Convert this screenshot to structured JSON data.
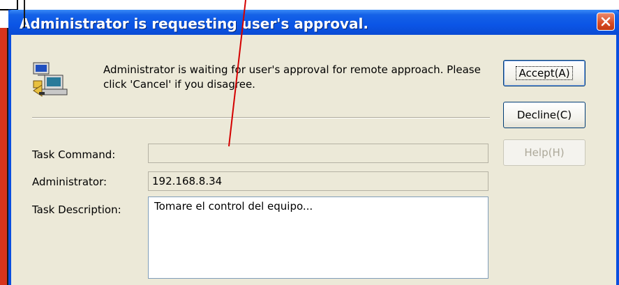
{
  "dialog": {
    "title": "Administrator is requesting user's approval.",
    "message": "Administrator is waiting for user's approval for remote approach. Please click 'Cancel' if you disagree.",
    "fields": {
      "task_command_label": "Task Command:",
      "task_command_value": "",
      "administrator_label": "Administrator:",
      "administrator_value": "192.168.8.34",
      "task_description_label": "Task Description:",
      "task_description_value": "Tomare el control del equipo..."
    },
    "buttons": {
      "accept": "Accept(A)",
      "decline": "Decline(C)",
      "help": "Help(H)"
    }
  },
  "icons": {
    "app": "computer-network-icon",
    "close": "close-icon"
  },
  "colors": {
    "titlebar": "#0b55e6",
    "client": "#ece9d8",
    "annotation": "#d40000",
    "close_button": "#d84a22"
  }
}
